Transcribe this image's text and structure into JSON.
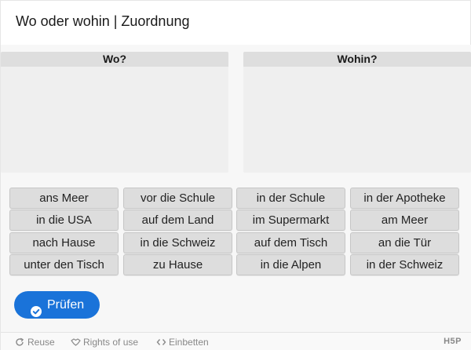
{
  "header": {
    "title": "Wo oder wohin | Zuordnung"
  },
  "dropzones": [
    {
      "label": "Wo?"
    },
    {
      "label": "Wohin?"
    }
  ],
  "draggables": [
    [
      "ans Meer",
      "vor die Schule",
      "in der Schule",
      "in der Apotheke"
    ],
    [
      "in die USA",
      "auf dem Land",
      "im Supermarkt",
      "am Meer"
    ],
    [
      "nach Hause",
      "in die Schweiz",
      "auf dem Tisch",
      "an die Tür"
    ],
    [
      "unter den Tisch",
      "zu Hause",
      "in die Alpen",
      "in der Schweiz"
    ]
  ],
  "check_button": {
    "label": "Prüfen",
    "icon": "check-circle-icon",
    "color": "#1a73d9"
  },
  "footer": {
    "reuse": "Reuse",
    "rights": "Rights of use",
    "embed": "Einbetten",
    "logo": "H5P"
  }
}
